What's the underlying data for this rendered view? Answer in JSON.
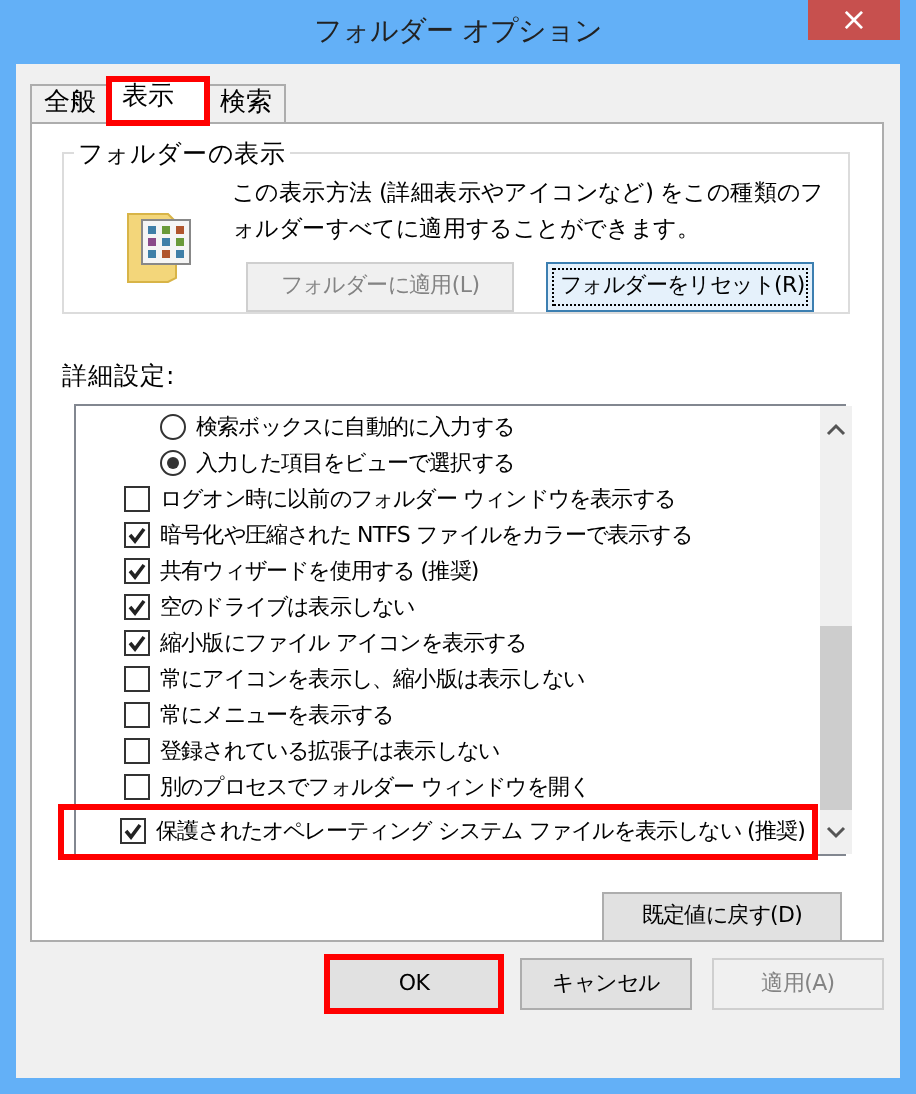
{
  "window": {
    "title": "フォルダー オプション",
    "close": "×"
  },
  "tabs": [
    {
      "label": "全般",
      "selected": false,
      "highlighted": false
    },
    {
      "label": "表示",
      "selected": true,
      "highlighted": true
    },
    {
      "label": "検索",
      "selected": false,
      "highlighted": false
    }
  ],
  "folder_views": {
    "title": "フォルダーの表示",
    "description": "この表示方法 (詳細表示やアイコンなど) をこの種類のフォルダーすべてに適用することができます。",
    "buttons": [
      {
        "label": "フォルダーに適用(L)",
        "disabled": true,
        "focused": false
      },
      {
        "label": "フォルダーをリセット(R)",
        "disabled": false,
        "focused": true
      }
    ]
  },
  "advanced": {
    "title": "詳細設定:",
    "items": [
      {
        "kind": "radio",
        "label": "検索ボックスに自動的に入力する",
        "checked": false,
        "highlighted": false
      },
      {
        "kind": "radio",
        "label": "入力した項目をビューで選択する",
        "checked": true,
        "highlighted": false
      },
      {
        "kind": "checkbox",
        "label": "ログオン時に以前のフォルダー ウィンドウを表示する",
        "checked": false,
        "highlighted": false
      },
      {
        "kind": "checkbox",
        "label": "暗号化や圧縮された NTFS ファイルをカラーで表示する",
        "checked": true,
        "highlighted": false
      },
      {
        "kind": "checkbox",
        "label": "共有ウィザードを使用する (推奨)",
        "checked": true,
        "highlighted": false
      },
      {
        "kind": "checkbox",
        "label": "空のドライブは表示しない",
        "checked": true,
        "highlighted": false
      },
      {
        "kind": "checkbox",
        "label": "縮小版にファイル アイコンを表示する",
        "checked": true,
        "highlighted": false
      },
      {
        "kind": "checkbox",
        "label": "常にアイコンを表示し、縮小版は表示しない",
        "checked": false,
        "highlighted": false
      },
      {
        "kind": "checkbox",
        "label": "常にメニューを表示する",
        "checked": false,
        "highlighted": false
      },
      {
        "kind": "checkbox",
        "label": "登録されている拡張子は表示しない",
        "checked": false,
        "highlighted": false
      },
      {
        "kind": "checkbox",
        "label": "別のプロセスでフォルダー ウィンドウを開く",
        "checked": false,
        "highlighted": false
      },
      {
        "kind": "checkbox",
        "label": "保護されたオペレーティング システム ファイルを表示しない (推奨)",
        "checked": true,
        "highlighted": true
      }
    ],
    "restore_button": "既定値に戻す(D)"
  },
  "footer_buttons": [
    {
      "label": "OK",
      "disabled": false,
      "highlighted": true
    },
    {
      "label": "キャンセル",
      "disabled": false,
      "highlighted": false
    },
    {
      "label": "適用(A)",
      "disabled": true,
      "highlighted": false
    }
  ]
}
